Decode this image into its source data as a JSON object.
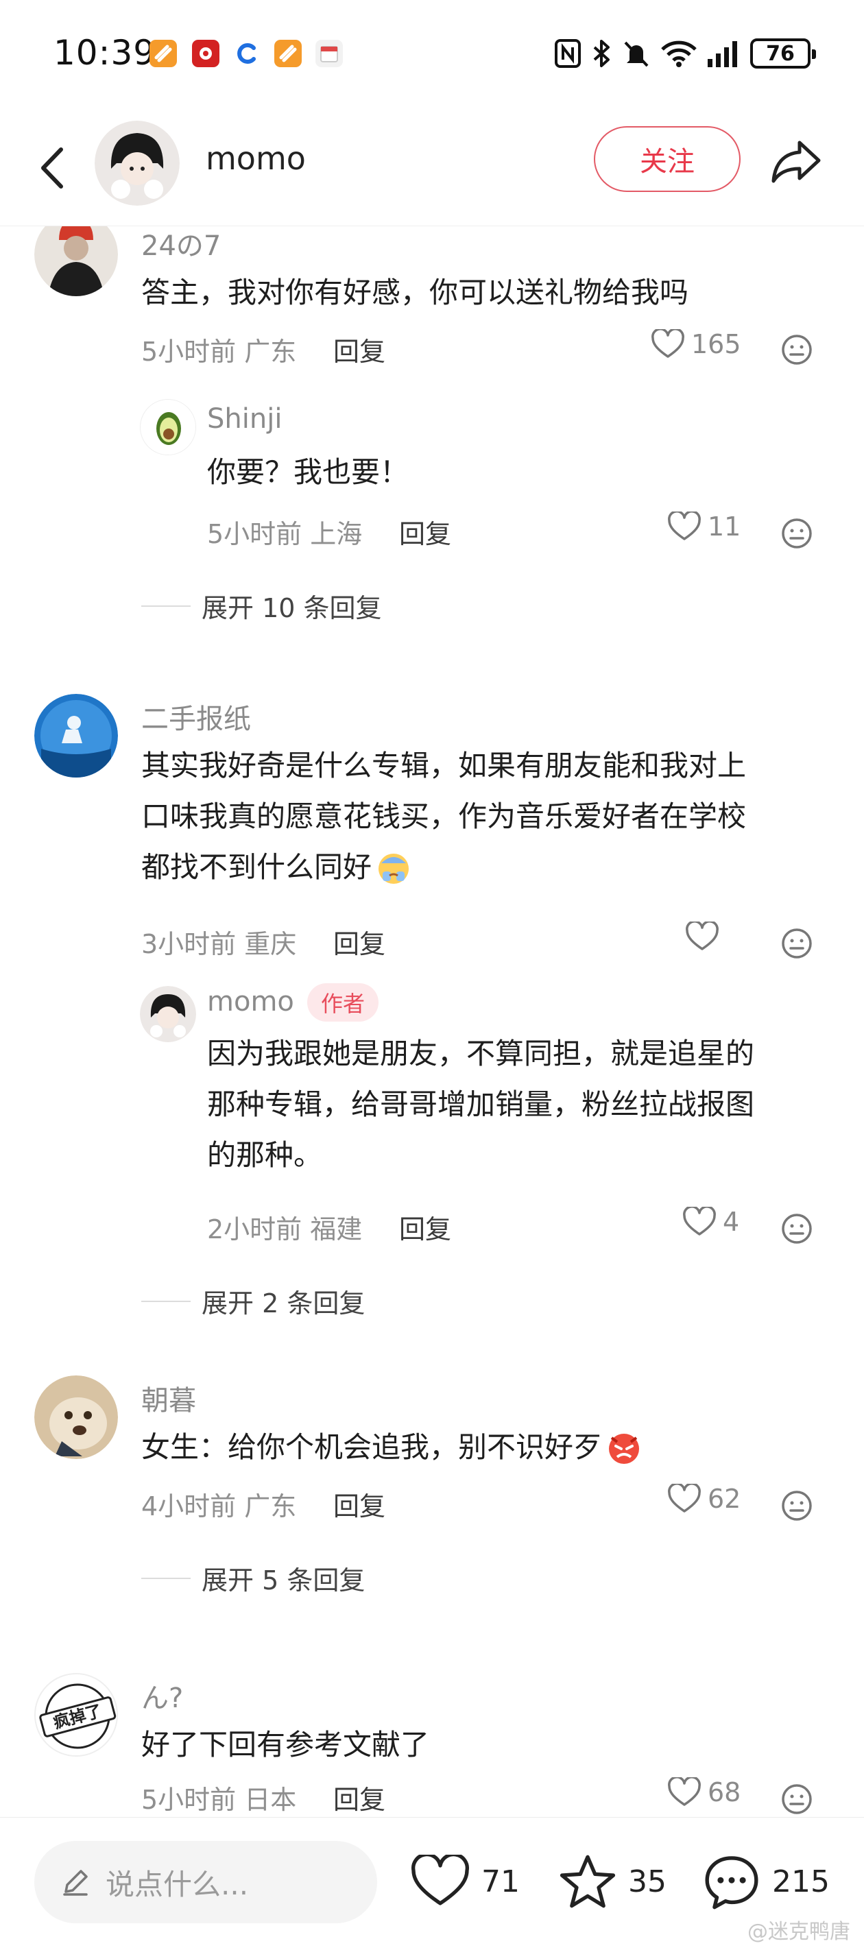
{
  "status_bar": {
    "time": "10:39",
    "battery": "76",
    "notification_icons": [
      "app-notif-icon",
      "video-notif-icon",
      "browser-notif-icon",
      "app-notif-icon",
      "calendar-notif-icon"
    ],
    "right_icons": [
      "nfc-icon",
      "bluetooth-icon",
      "mute-icon",
      "wifi-icon",
      "signal-icon",
      "battery-icon"
    ]
  },
  "header": {
    "name": "momo",
    "follow_label": "关注"
  },
  "comments": [
    {
      "username": "24の7",
      "text": "答主，我对你有好感，你可以送礼物给我吗",
      "time": "5小时前",
      "location": "广东",
      "reply_label": "回复",
      "likes": "165"
    },
    {
      "username": "Shinji",
      "text": "你要？我也要！",
      "time": "5小时前",
      "location": "上海",
      "reply_label": "回复",
      "likes": "11"
    },
    {
      "username": "二手报纸",
      "text_lines": [
        "其实我好奇是什么专辑，如果有朋友能和我对上",
        "口味我真的愿意花钱买，作为音乐爱好者在学校",
        "都找不到什么同好"
      ],
      "time": "3小时前",
      "location": "重庆",
      "reply_label": "回复",
      "likes": ""
    },
    {
      "username": "momo",
      "badge": "作者",
      "text_lines": [
        "因为我跟她是朋友，不算同担，就是追星的",
        "那种专辑，给哥哥增加销量，粉丝拉战报图",
        "的那种。"
      ],
      "time": "2小时前",
      "location": "福建",
      "reply_label": "回复",
      "likes": "4"
    },
    {
      "username": "朝暮",
      "text": "女生：给你个机会追我，别不识好歹",
      "time": "4小时前",
      "location": "广东",
      "reply_label": "回复",
      "likes": "62"
    },
    {
      "username": "ん?",
      "text": "好了下回有参考文献了",
      "time": "5小时前",
      "location": "日本",
      "reply_label": "回复",
      "likes": "68"
    }
  ],
  "expand": [
    "展开 10 条回复",
    "展开 2 条回复",
    "展开 5 条回复"
  ],
  "avatar_badge_text": "疯掉了",
  "bottom_bar": {
    "placeholder": "说点什么...",
    "likes": "71",
    "stars": "35",
    "comments": "215"
  },
  "watermark": "@迷克鸭唐",
  "colors": {
    "accent": "#e8394a",
    "badge_bg": "#fde8ea",
    "meta": "#8f8f8f"
  }
}
